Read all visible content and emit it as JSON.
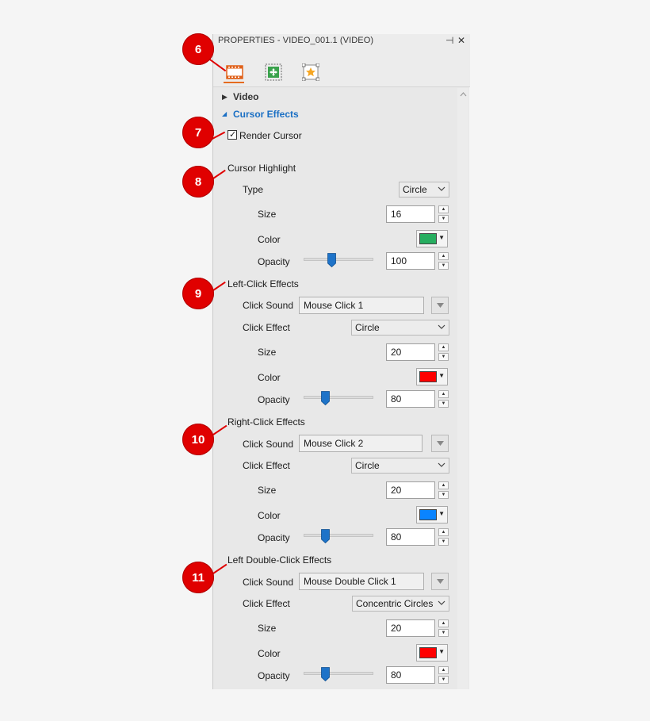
{
  "panel": {
    "title": "PROPERTIES - VIDEO_001.1 (VIDEO)",
    "pin_glyph": "⊣",
    "close_glyph": "✕",
    "toolbar_icons": [
      "film-icon",
      "move-icon",
      "star-frame-icon"
    ]
  },
  "sections": {
    "video": {
      "label": "Video",
      "arrow": "▶"
    },
    "cursor_effects": {
      "label": "Cursor Effects",
      "arrow": "◢"
    }
  },
  "render_cursor": {
    "label": "Render Cursor",
    "checked": true,
    "check_glyph": "✓"
  },
  "cursor_highlight": {
    "header": "Cursor Highlight",
    "type_label": "Type",
    "type_value": "Circle",
    "size_label": "Size",
    "size_value": "16",
    "color_label": "Color",
    "color": "#27ae60",
    "opacity_label": "Opacity",
    "opacity_value": "100"
  },
  "left_click": {
    "header": "Left-Click Effects",
    "sound_label": "Click Sound",
    "sound_value": "Mouse Click 1",
    "effect_label": "Click Effect",
    "effect_value": "Circle",
    "size_label": "Size",
    "size_value": "20",
    "color_label": "Color",
    "color": "#ff0000",
    "opacity_label": "Opacity",
    "opacity_value": "80"
  },
  "right_click": {
    "header": "Right-Click Effects",
    "sound_label": "Click Sound",
    "sound_value": "Mouse Click 2",
    "effect_label": "Click Effect",
    "effect_value": "Circle",
    "size_label": "Size",
    "size_value": "20",
    "color_label": "Color",
    "color": "#0a84ff",
    "opacity_label": "Opacity",
    "opacity_value": "80"
  },
  "double_click": {
    "header": "Left Double-Click Effects",
    "sound_label": "Click Sound",
    "sound_value": "Mouse Double Click 1",
    "effect_label": "Click Effect",
    "effect_value": "Concentric Circles",
    "size_label": "Size",
    "size_value": "20",
    "color_label": "Color",
    "color": "#ff0000",
    "opacity_label": "Opacity",
    "opacity_value": "80"
  },
  "callouts": [
    "6",
    "7",
    "8",
    "9",
    "10",
    "11"
  ],
  "colors": {
    "callout": "#e00000",
    "accent_blue": "#1a6fc4",
    "slider_thumb": "#1e73c8"
  }
}
